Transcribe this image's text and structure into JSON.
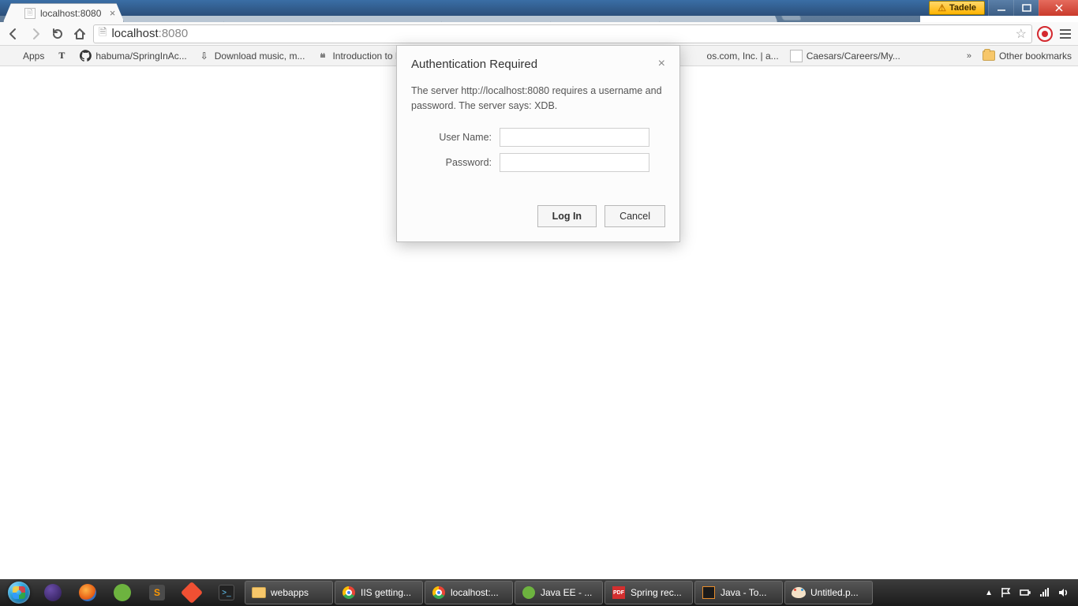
{
  "window": {
    "user_badge": "Tadele"
  },
  "tabs": {
    "active_title": "localhost:8080"
  },
  "omnibox": {
    "host": "localhost",
    "port": ":8080"
  },
  "bookmarks": {
    "apps": "Apps",
    "items": [
      "habuma/SpringInAc...",
      "Download music, m...",
      "Introduction to L",
      "os.com, Inc. | a...",
      "Caesars/Careers/My..."
    ],
    "overflow": "»",
    "other": "Other bookmarks"
  },
  "dialog": {
    "title": "Authentication Required",
    "message": "The server http://localhost:8080 requires a username and password. The server says: XDB.",
    "user_label": "User Name:",
    "pass_label": "Password:",
    "login": "Log In",
    "cancel": "Cancel"
  },
  "taskbar": {
    "apps": [
      {
        "label": "webapps"
      },
      {
        "label": "IIS getting..."
      },
      {
        "label": "localhost:..."
      },
      {
        "label": "Java EE - ..."
      },
      {
        "label": "Spring rec..."
      },
      {
        "label": "Java - To..."
      },
      {
        "label": "Untitled.p..."
      }
    ]
  }
}
